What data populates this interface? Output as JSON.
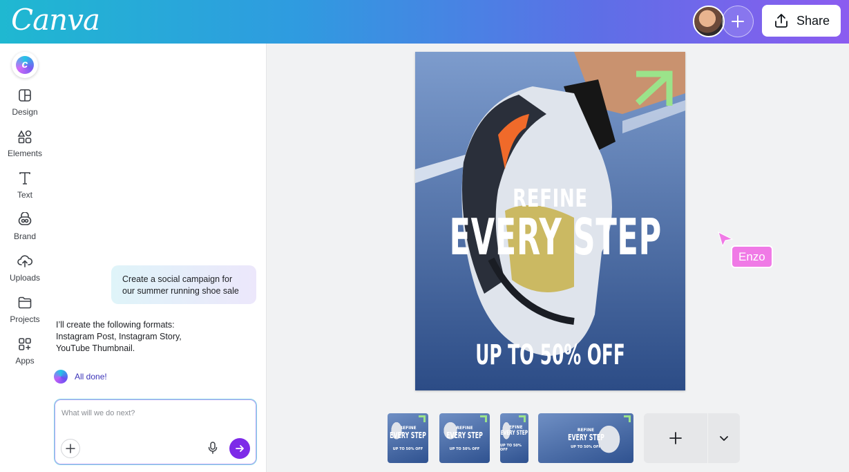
{
  "header": {
    "logo_text": "Canva",
    "share_label": "Share",
    "avatar_icon": "user-avatar",
    "add_collaborator_icon": "plus-icon"
  },
  "rail": {
    "items": [
      {
        "label": "Design",
        "icon": "layout-icon"
      },
      {
        "label": "Elements",
        "icon": "shapes-icon"
      },
      {
        "label": "Text",
        "icon": "text-icon"
      },
      {
        "label": "Brand",
        "icon": "brand-icon"
      },
      {
        "label": "Uploads",
        "icon": "upload-cloud-icon"
      },
      {
        "label": "Projects",
        "icon": "folder-icon"
      },
      {
        "label": "Apps",
        "icon": "apps-icon"
      }
    ]
  },
  "chat": {
    "user_message": "Create a social campaign for our summer running shoe sale",
    "assistant_reply": "I’ll create the following formats: Instagram Post, Instagram Story, YouTube Thumbnail.",
    "status": "All done!",
    "input_placeholder": "What will we do next?"
  },
  "design": {
    "line1": "REFINE",
    "line2": "EVERY STEP",
    "line3": "UP TO 50% OFF",
    "arrow_color": "#9be38a"
  },
  "collaborator": {
    "name": "Enzo",
    "color": "#f07ae6"
  },
  "pages": [
    {
      "line1": "REFINE",
      "line2": "EVERY STEP",
      "line3": "UP TO 50% OFF"
    },
    {
      "line1": "REFINE",
      "line2": "EVERY STEP",
      "line3": "UP TO 50% OFF"
    },
    {
      "line1": "REFINE",
      "line2": "EVERY STEP",
      "line3": "UP TO 50% OFF"
    },
    {
      "line1": "REFINE",
      "line2": "EVERY STEP",
      "line3": "UP TO 50% OFF"
    }
  ],
  "colors": {
    "accent": "#7d2ae8",
    "header_gradient_start": "#1fb8d1",
    "header_gradient_end": "#8b5cf0"
  }
}
